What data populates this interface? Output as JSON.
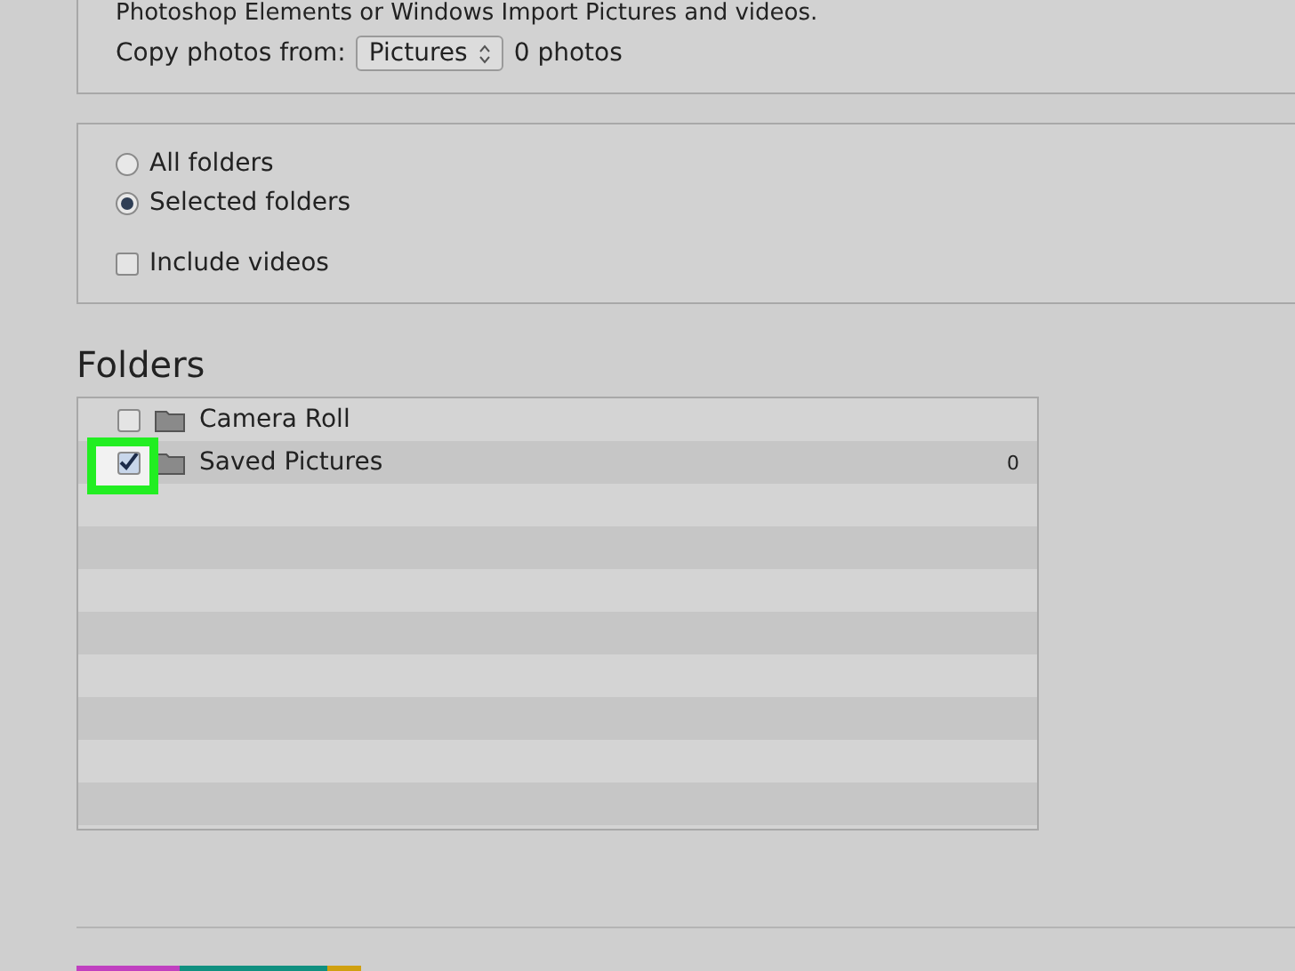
{
  "intro": {
    "text": "Photoshop Elements or Windows Import Pictures and videos."
  },
  "source": {
    "label": "Copy photos from:",
    "value": "Pictures",
    "count": "0 photos"
  },
  "options": [
    {
      "kind": "radio",
      "label": "All folders",
      "selected": false
    },
    {
      "kind": "radio",
      "label": "Selected folders",
      "selected": true
    },
    {
      "kind": "checkbox",
      "label": "Include videos",
      "checked": false
    }
  ],
  "folders": {
    "title": "Folders",
    "items": [
      {
        "name": "Camera Roll",
        "checked": false,
        "highlighted": false
      },
      {
        "name": "Saved Pictures",
        "checked": true,
        "count": "0",
        "highlighted": true
      }
    ]
  }
}
